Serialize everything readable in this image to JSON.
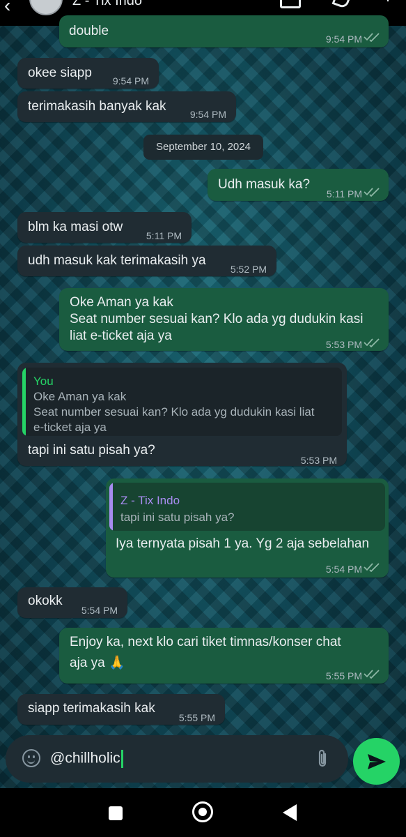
{
  "header": {
    "back_glyph": "‹",
    "contact_name": "Z - Tix Indo",
    "more_glyph": "⋮"
  },
  "messages": [
    {
      "dir": "out",
      "text": "double",
      "time": "9:54 PM"
    },
    {
      "dir": "in",
      "text": "okee siapp",
      "time": "9:54 PM"
    },
    {
      "dir": "in",
      "text": "terimakasih banyak kak",
      "time": "9:54 PM"
    },
    {
      "dir": "out",
      "text": "Udh masuk ka?",
      "time": "5:11 PM"
    },
    {
      "dir": "in",
      "text": "blm ka masi otw",
      "time": "5:11 PM"
    },
    {
      "dir": "in",
      "text": "udh masuk kak terimakasih ya",
      "time": "5:52 PM"
    },
    {
      "dir": "out",
      "text_line1": "Oke Aman ya kak",
      "text_line2": "Seat number sesuai kan? Klo ada yg dudukin kasi",
      "text_line3": "liat e-ticket aja ya",
      "time": "5:53 PM"
    },
    {
      "dir": "in",
      "quote_name": "You",
      "quote_line1": "Oke Aman ya kak",
      "quote_line2": "Seat number sesuai kan? Klo ada yg dudukin kasi liat",
      "quote_line3": "e-ticket aja ya",
      "text": "tapi ini satu pisah ya?",
      "time": "5:53 PM"
    },
    {
      "dir": "out",
      "quote_name": "Z - Tix Indo",
      "quote_line1": "tapi ini satu pisah ya?",
      "text": "Iya ternyata pisah 1 ya. Yg 2 aja sebelahan",
      "time": "5:54 PM"
    },
    {
      "dir": "in",
      "text": "okokk",
      "time": "5:54 PM"
    },
    {
      "dir": "out",
      "text_line1": "Enjoy ka, next klo cari tiket timnas/konser chat",
      "text_line2": "aja ya 🙏",
      "time": "5:55 PM"
    },
    {
      "dir": "in",
      "text": "siapp terimakasih kak",
      "time": "5:55 PM"
    }
  ],
  "date_separator": "September 10, 2024",
  "composer": {
    "value": "@chillholic"
  },
  "colors": {
    "incoming": "#202c33",
    "outgoing": "#1a5c40",
    "send_button": "#25d366",
    "quote_you": "#25d366",
    "quote_other": "#a88cf0",
    "ticks": "#8eb8a6"
  },
  "icons": [
    "back-arrow-icon",
    "video-call-icon",
    "voice-call-icon",
    "more-icon",
    "emoji-icon",
    "attach-icon",
    "send-icon",
    "nav-recents-icon",
    "nav-home-icon",
    "nav-back-icon"
  ]
}
